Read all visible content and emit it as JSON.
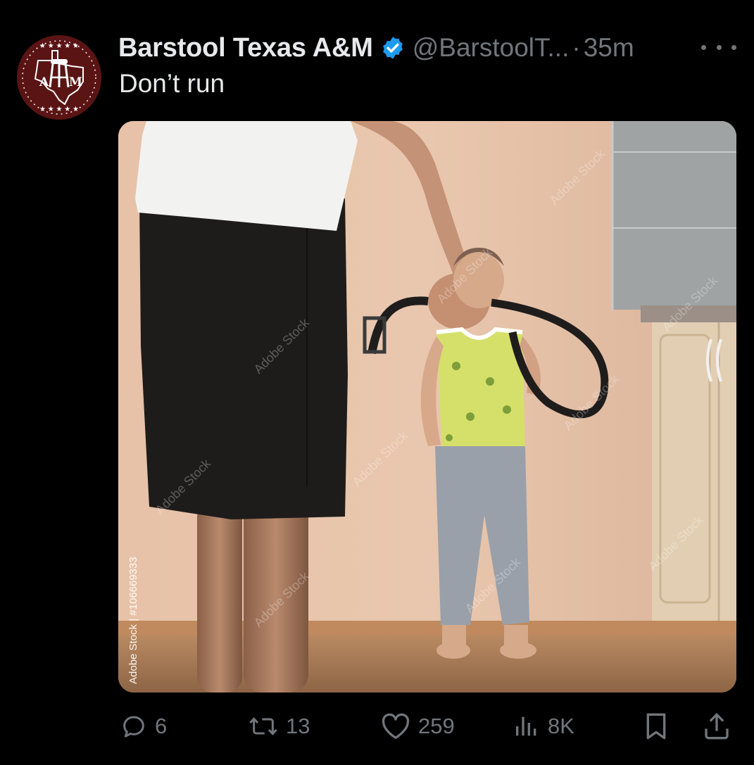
{
  "tweet": {
    "display_name": "Barstool Texas A&M",
    "handle": "@BarstoolT...",
    "separator": "·",
    "time": "35m",
    "text": "Don’t run",
    "avatar_text": "AM"
  },
  "media": {
    "watermark_side": "Adobe Stock | #106669333",
    "watermark_tile": "Adobe Stock"
  },
  "actions": {
    "replies": "6",
    "reposts": "13",
    "likes": "259",
    "views": "8K"
  },
  "icons": [
    "verified-badge-icon",
    "more-icon",
    "reply-icon",
    "repost-icon",
    "like-icon",
    "views-icon",
    "bookmark-icon",
    "share-icon"
  ],
  "colors": {
    "background": "#000000",
    "primary_text": "#e7e9ea",
    "secondary_text": "#71767b",
    "verified_blue": "#1d9bf0",
    "avatar_maroon": "#5a1414"
  }
}
